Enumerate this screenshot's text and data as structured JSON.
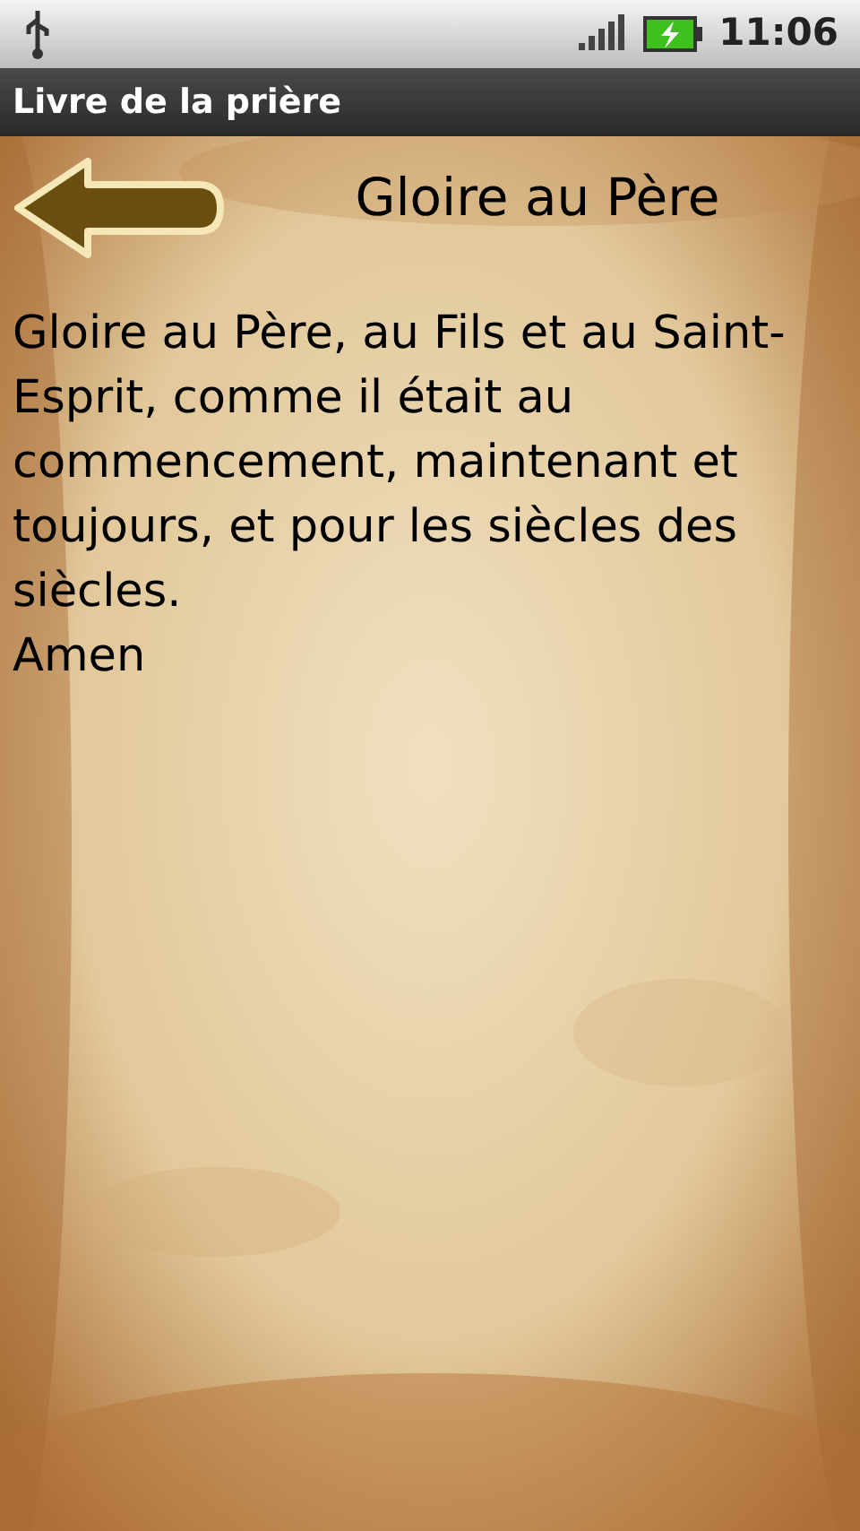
{
  "status_bar": {
    "time": "11:06"
  },
  "app_bar": {
    "title": "Livre de la prière"
  },
  "prayer": {
    "title": "Gloire au Père",
    "text": "Gloire au Père, au Fils et au Saint-Esprit, comme il était au commencement, maintenant et toujours, et pour les siècles des siècles.",
    "closing": "Amen"
  }
}
